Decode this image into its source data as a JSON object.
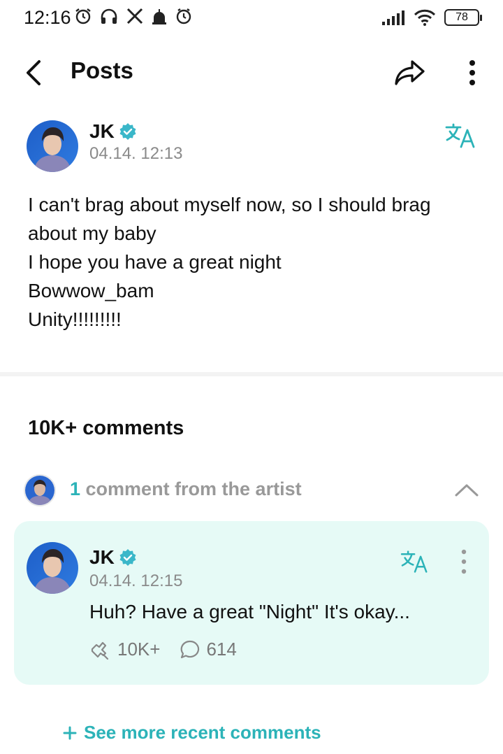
{
  "status_bar": {
    "time": "12:16",
    "battery": "78",
    "left_icons": [
      "alarm-icon",
      "headphones-icon",
      "x-app-icon",
      "mosque-icon",
      "clock-icon"
    ],
    "right_icons": [
      "signal-icon",
      "wifi-icon",
      "battery-icon"
    ]
  },
  "header": {
    "title": "Posts"
  },
  "post": {
    "author": "JK",
    "timestamp": "04.14. 12:13",
    "lines": [
      "I can't brag about myself now, so I should brag",
      "about my baby",
      "I hope you have a great night",
      "Bowwow_bam",
      "Unity!!!!!!!!!"
    ]
  },
  "comments": {
    "count_label": "10K+ comments",
    "artist_count": "1",
    "artist_label": " comment from the artist",
    "artist_comment": {
      "author": "JK",
      "timestamp": "04.14. 12:15",
      "text": "Huh? Have a great \"Night\" It's okay...",
      "likes": "10K+",
      "replies": "614"
    },
    "see_more": "See more recent comments"
  },
  "colors": {
    "accent": "#2cb3b8",
    "card_bg": "#e6faf6",
    "verified": "#3ab7c9",
    "muted": "#8a8a8a"
  }
}
